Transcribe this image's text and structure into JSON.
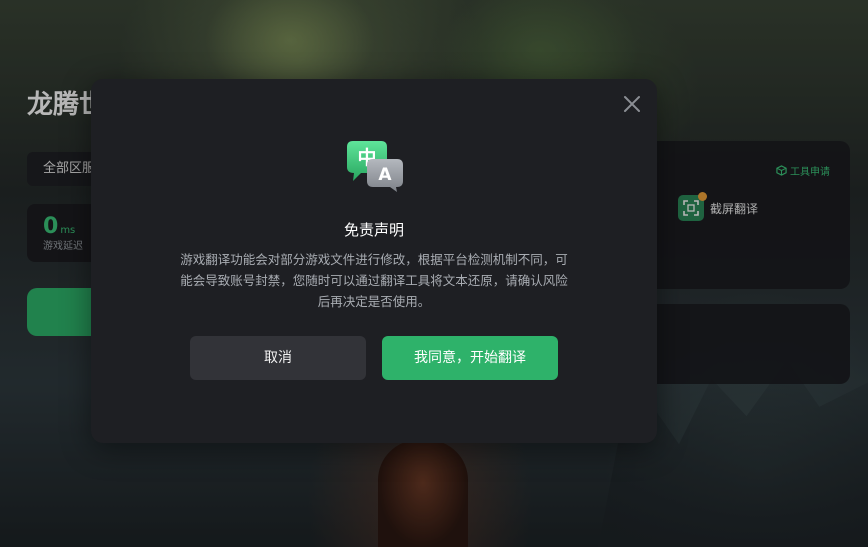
{
  "page": {
    "title": "龙腾世",
    "region_select": "全部区服",
    "latency": {
      "value": "0",
      "unit": "ms",
      "label": "游戏延迟"
    }
  },
  "tools": {
    "apply_label": "工具申请",
    "screenshot_translate_label": "截屏翻译"
  },
  "dialog": {
    "icon": {
      "front_glyph": "中",
      "back_glyph": "A"
    },
    "title": "免责声明",
    "body": "游戏翻译功能会对部分游戏文件进行修改，根据平台检测机制不同，可能会导致账号封禁，您随时可以通过翻译工具将文本还原，请确认风险后再决定是否使用。",
    "cancel_label": "取消",
    "agree_label": "我同意，开始翻译"
  },
  "colors": {
    "accent_green": "#2eb26a",
    "dialog_bg": "#1e1f23",
    "cancel_bg": "#323338",
    "body_text": "#a9adb3"
  }
}
